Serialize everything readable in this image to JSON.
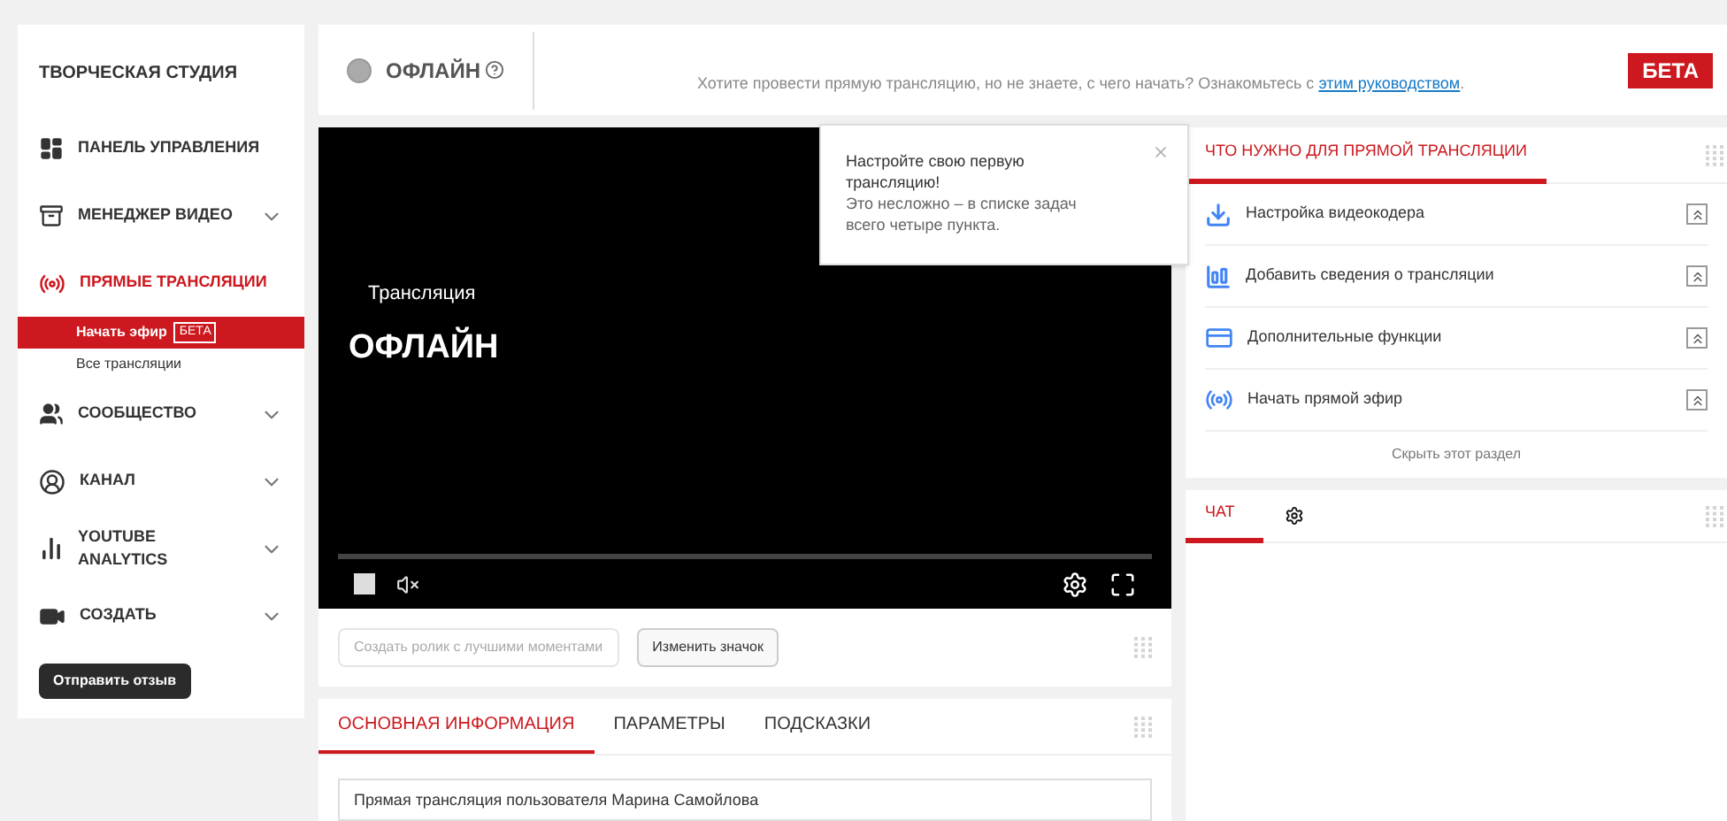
{
  "sidebar": {
    "title": "ТВОРЧЕСКАЯ СТУДИЯ",
    "items": [
      {
        "label": "ПАНЕЛЬ УПРАВЛЕНИЯ",
        "expandable": false,
        "selected": false
      },
      {
        "label": "МЕНЕДЖЕР ВИДЕО",
        "expandable": true,
        "selected": false
      },
      {
        "label": "ПРЯМЫЕ ТРАНСЛЯЦИИ",
        "expandable": false,
        "selected": true,
        "children": [
          {
            "label": "Начать эфир",
            "badge": "БЕТА",
            "selected": true
          },
          {
            "label": "Все трансляции",
            "selected": false
          }
        ]
      },
      {
        "label": "СООБЩЕСТВО",
        "expandable": true,
        "selected": false
      },
      {
        "label": "КАНАЛ",
        "expandable": true,
        "selected": false
      },
      {
        "label": "YOUTUBE ANALYTICS",
        "expandable": true,
        "selected": false
      },
      {
        "label": "СОЗДАТЬ",
        "expandable": true,
        "selected": false
      }
    ],
    "feedback_button": "Отправить отзыв"
  },
  "header": {
    "status": "ОФЛАЙН",
    "hint": "Хотите провести прямую трансляцию, но не знаете, с чего начать? Ознакомьтесь с",
    "link": "этим руководством",
    "hint_end": ".",
    "badge": "БЕТА"
  },
  "player": {
    "label": "Трансляция",
    "status": "ОФЛАЙН"
  },
  "actions": [
    {
      "label": "Создать ролик с лучшими моментами",
      "disabled": true
    },
    {
      "label": "Изменить значок",
      "disabled": false
    }
  ],
  "info_tabs": [
    {
      "label": "ОСНОВНАЯ ИНФОРМАЦИЯ",
      "selected": true
    },
    {
      "label": "ПАРАМЕТРЫ",
      "selected": false
    },
    {
      "label": "ПОДСКАЗКИ",
      "selected": false
    }
  ],
  "title_field": {
    "value": "Прямая трансляция пользователя Марина Самойлова"
  },
  "tooltip": {
    "title": "Настройте свою первую трансляцию!",
    "body": "Это несложно – в списке задач всего четыре пункта."
  },
  "checklist": {
    "tab": "ЧТО НУЖНО ДЛЯ ПРЯМОЙ ТРАНСЛЯЦИИ",
    "items": [
      {
        "label": "Настройка видеокодера"
      },
      {
        "label": "Добавить сведения о трансляции"
      },
      {
        "label": "Дополнительные функции"
      },
      {
        "label": "Начать прямой эфир"
      }
    ],
    "hide_link": "Скрыть этот раздел"
  },
  "chat": {
    "tab": "ЧАТ"
  }
}
